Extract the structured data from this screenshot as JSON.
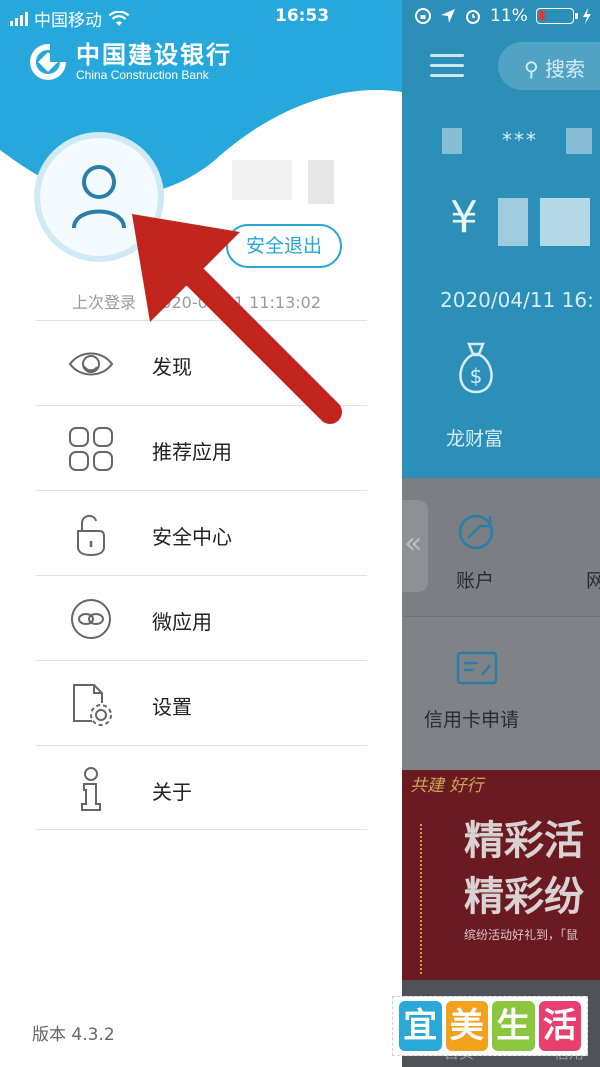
{
  "status_bar": {
    "carrier": "中国移动",
    "time": "16:53",
    "battery": "11%"
  },
  "drawer": {
    "logo": {
      "name_cn": "中国建设银行",
      "name_en": "China Construction Bank"
    },
    "logout_label": "安全退出",
    "last_login": {
      "label": "上次登录",
      "value": "2020-04-11 11:13:02"
    },
    "menu": [
      {
        "label": "发现",
        "icon": "eye-icon"
      },
      {
        "label": "推荐应用",
        "icon": "app-grid-icon"
      },
      {
        "label": "安全中心",
        "icon": "padlock-icon"
      },
      {
        "label": "微应用",
        "icon": "link-circle-icon"
      },
      {
        "label": "设置",
        "icon": "settings-document-icon"
      },
      {
        "label": "关于",
        "icon": "info-person-icon"
      }
    ],
    "version": "版本 4.3.2"
  },
  "background_app": {
    "search_placeholder": "搜索",
    "masked_account": "***",
    "currency_symbol": "¥",
    "date": "2020/04/11 16:",
    "wealth_label": "龙财富",
    "account_label": "账户",
    "partial_label": "网",
    "credit_card_label": "信用卡申请",
    "banner": {
      "calligraphy": "共建 好行",
      "line1": "精彩活",
      "line2": "精彩纷",
      "caption": "缤纷活动好礼到，「鼠"
    },
    "bottom_labels": [
      "首页",
      "信用"
    ]
  },
  "watermark": {
    "chars": [
      "宜",
      "美",
      "生",
      "活"
    ],
    "colors": [
      "#2aa8d8",
      "#f2a21c",
      "#8cc63f",
      "#e83f6f"
    ]
  },
  "colors": {
    "header_blue": "#27a8dc",
    "accent_blue": "#27a5d8",
    "arrow_red": "#c0241d"
  }
}
